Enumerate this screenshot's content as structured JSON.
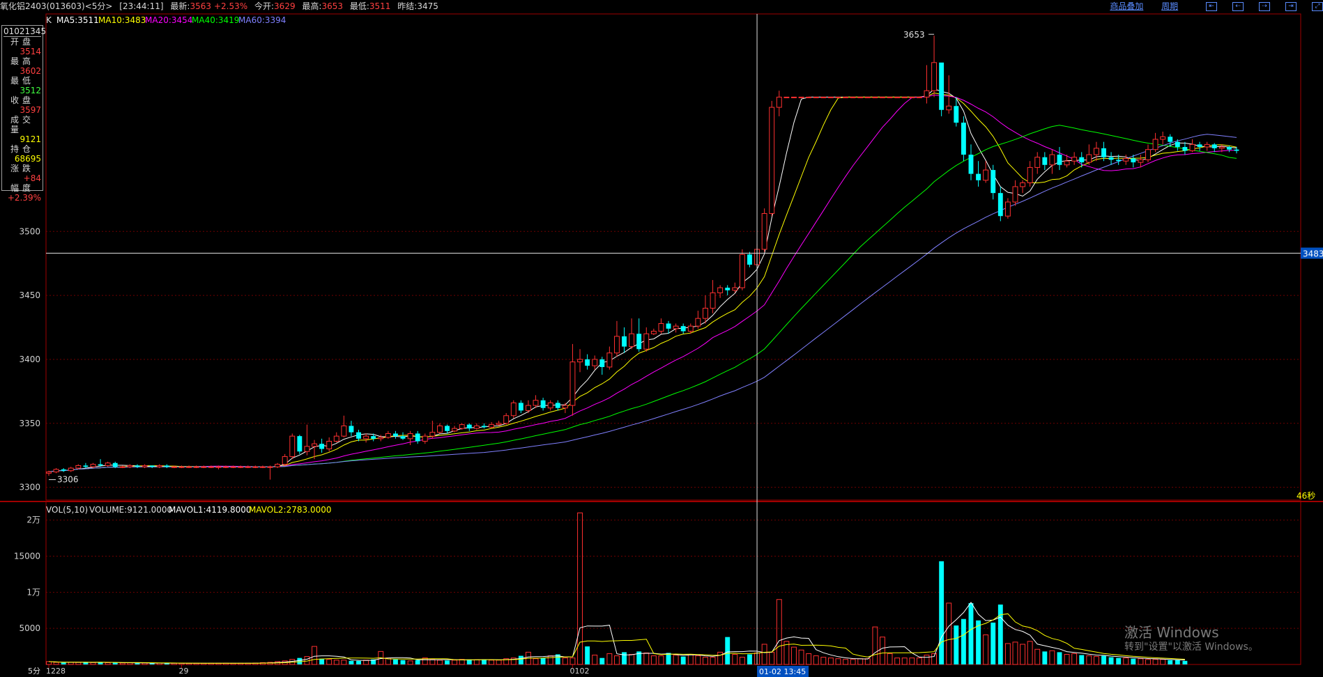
{
  "header": {
    "symbol": "氧化铝2403(013603)<5分>",
    "time": "[23:44:11]",
    "latest_label": "最新:",
    "latest": "3563",
    "change_pct": "+2.53%",
    "open_label": "今开:",
    "open": "3629",
    "high_label": "最高:",
    "high": "3653",
    "low_label": "最低:",
    "low": "3511",
    "prev_label": "昨结:",
    "prev": "3475",
    "overlay_link": "商品叠加",
    "period_link": "周期"
  },
  "info_panel": {
    "code": "01021345",
    "rows": [
      {
        "label": "开盘",
        "value": "3514",
        "color": "#ff4040"
      },
      {
        "label": "最高",
        "value": "3602",
        "color": "#ff4040"
      },
      {
        "label": "最低",
        "value": "3512",
        "color": "#40ff40"
      },
      {
        "label": "收盘",
        "value": "3597",
        "color": "#ff4040"
      },
      {
        "label": "成交量",
        "value": "9121",
        "color": "#ffff00"
      },
      {
        "label": "持仓",
        "value": "68695",
        "color": "#ffff00"
      },
      {
        "label": "涨跌",
        "value": "+84",
        "color": "#ff4040"
      },
      {
        "label": "幅度",
        "value": "+2.39%",
        "color": "#ff4040"
      }
    ]
  },
  "ma_legend": {
    "k": "K",
    "ma5": "MA5:3511",
    "ma10": "MA10:3483",
    "ma20": "MA20:3454",
    "ma40": "MA40:3419",
    "ma60": "MA60:3394",
    "colors": {
      "ma5": "#ffffff",
      "ma10": "#ffff00",
      "ma20": "#ff00ff",
      "ma40": "#00ff00",
      "ma60": "#8080ff"
    }
  },
  "vol_legend": {
    "prefix": "VOL(5,10)",
    "volume": "VOLUME:9121.0000",
    "mavol1": "MAVOL1:4119.8000",
    "mavol2": "MAVOL2:2783.0000"
  },
  "annotations": {
    "max_label": "3653",
    "min_label": "3306",
    "crosshair_price": "3483",
    "crosshair_time": "01-02 13:45",
    "countdown": "46秒",
    "period": "5分"
  },
  "watermark": {
    "line1": "激活 Windows",
    "line2": "转到\"设置\"以激活 Windows。"
  },
  "chart_data": {
    "type": "candlestick",
    "price_axis": {
      "ticks": [
        3300,
        3350,
        3400,
        3450,
        3500
      ],
      "range": [
        3290,
        3670
      ]
    },
    "volume_axis": {
      "ticks": [
        "5000",
        "1万",
        "15000",
        "2万"
      ],
      "tick_values": [
        5000,
        10000,
        15000,
        20000
      ],
      "range": [
        0,
        22000
      ]
    },
    "x_labels": [
      {
        "label": "1228",
        "index": 0
      },
      {
        "label": "29",
        "index": 18
      },
      {
        "label": "0102",
        "index": 71
      }
    ],
    "crosshair_index": 96,
    "candles": [
      [
        3311,
        3312,
        3309,
        3313
      ],
      [
        3312,
        3314,
        3311,
        3315
      ],
      [
        3314,
        3313,
        3312,
        3315
      ],
      [
        3313,
        3315,
        3312,
        3316
      ],
      [
        3315,
        3317,
        3314,
        3318
      ],
      [
        3317,
        3316,
        3315,
        3319
      ],
      [
        3316,
        3318,
        3315,
        3319
      ],
      [
        3318,
        3317,
        3316,
        3322
      ],
      [
        3317,
        3319,
        3316,
        3320
      ],
      [
        3319,
        3316,
        3315,
        3320
      ],
      [
        3316,
        3316,
        3315,
        3317
      ],
      [
        3316,
        3317,
        3315,
        3318
      ],
      [
        3317,
        3316,
        3315,
        3318
      ],
      [
        3316,
        3317,
        3315,
        3318
      ],
      [
        3317,
        3316,
        3315,
        3317
      ],
      [
        3316,
        3317,
        3315,
        3318
      ],
      [
        3317,
        3316,
        3315,
        3318
      ],
      [
        3316,
        3316,
        3315,
        3317
      ],
      [
        3316,
        3316,
        3315,
        3317
      ],
      [
        3316,
        3316,
        3315,
        3317
      ],
      [
        3316,
        3316,
        3315,
        3317
      ],
      [
        3316,
        3316,
        3315,
        3317
      ],
      [
        3316,
        3316,
        3315,
        3317
      ],
      [
        3316,
        3316,
        3314,
        3317
      ],
      [
        3316,
        3316,
        3315,
        3317
      ],
      [
        3316,
        3316,
        3315,
        3317
      ],
      [
        3316,
        3316,
        3315,
        3317
      ],
      [
        3316,
        3316,
        3315,
        3317
      ],
      [
        3316,
        3316,
        3315,
        3317
      ],
      [
        3316,
        3316,
        3315,
        3317
      ],
      [
        3316,
        3316,
        3306,
        3317
      ],
      [
        3316,
        3318,
        3315,
        3319
      ],
      [
        3318,
        3324,
        3317,
        3326
      ],
      [
        3324,
        3340,
        3322,
        3342
      ],
      [
        3340,
        3328,
        3326,
        3341
      ],
      [
        3328,
        3332,
        3325,
        3349
      ],
      [
        3332,
        3334,
        3322,
        3337
      ],
      [
        3334,
        3330,
        3327,
        3338
      ],
      [
        3330,
        3336,
        3328,
        3339
      ],
      [
        3336,
        3340,
        3335,
        3343
      ],
      [
        3340,
        3348,
        3339,
        3356
      ],
      [
        3348,
        3343,
        3340,
        3352
      ],
      [
        3343,
        3338,
        3336,
        3345
      ],
      [
        3338,
        3340,
        3335,
        3342
      ],
      [
        3340,
        3338,
        3336,
        3342
      ],
      [
        3338,
        3339,
        3336,
        3341
      ],
      [
        3339,
        3342,
        3338,
        3344
      ],
      [
        3342,
        3340,
        3338,
        3344
      ],
      [
        3340,
        3338,
        3337,
        3343
      ],
      [
        3338,
        3342,
        3333,
        3344
      ],
      [
        3342,
        3336,
        3334,
        3344
      ],
      [
        3336,
        3340,
        3334,
        3342
      ],
      [
        3340,
        3343,
        3338,
        3352
      ],
      [
        3343,
        3348,
        3342,
        3350
      ],
      [
        3348,
        3344,
        3342,
        3349
      ],
      [
        3344,
        3346,
        3343,
        3348
      ],
      [
        3346,
        3349,
        3345,
        3350
      ],
      [
        3349,
        3346,
        3344,
        3350
      ],
      [
        3346,
        3348,
        3345,
        3350
      ],
      [
        3348,
        3347,
        3346,
        3350
      ],
      [
        3347,
        3349,
        3346,
        3351
      ],
      [
        3349,
        3350,
        3348,
        3352
      ],
      [
        3350,
        3356,
        3349,
        3358
      ],
      [
        3356,
        3366,
        3354,
        3368
      ],
      [
        3366,
        3360,
        3358,
        3368
      ],
      [
        3360,
        3364,
        3358,
        3368
      ],
      [
        3364,
        3368,
        3362,
        3372
      ],
      [
        3368,
        3362,
        3360,
        3370
      ],
      [
        3362,
        3366,
        3360,
        3368
      ],
      [
        3366,
        3362,
        3360,
        3368
      ],
      [
        3362,
        3364,
        3358,
        3366
      ],
      [
        3364,
        3398,
        3356,
        3412
      ],
      [
        3398,
        3400,
        3390,
        3408
      ],
      [
        3400,
        3395,
        3392,
        3404
      ],
      [
        3395,
        3400,
        3392,
        3403
      ],
      [
        3400,
        3394,
        3388,
        3402
      ],
      [
        3394,
        3405,
        3392,
        3410
      ],
      [
        3405,
        3418,
        3402,
        3430
      ],
      [
        3418,
        3410,
        3405,
        3425
      ],
      [
        3410,
        3420,
        3408,
        3432
      ],
      [
        3420,
        3408,
        3406,
        3432
      ],
      [
        3408,
        3420,
        3406,
        3425
      ],
      [
        3420,
        3422,
        3419,
        3424
      ],
      [
        3422,
        3428,
        3420,
        3432
      ],
      [
        3428,
        3424,
        3420,
        3430
      ],
      [
        3424,
        3426,
        3421,
        3428
      ],
      [
        3426,
        3422,
        3420,
        3428
      ],
      [
        3422,
        3426,
        3420,
        3428
      ],
      [
        3426,
        3432,
        3424,
        3438
      ],
      [
        3432,
        3440,
        3428,
        3450
      ],
      [
        3440,
        3452,
        3436,
        3462
      ],
      [
        3452,
        3456,
        3448,
        3458
      ],
      [
        3456,
        3454,
        3450,
        3458
      ],
      [
        3454,
        3456,
        3452,
        3460
      ],
      [
        3456,
        3482,
        3454,
        3486
      ],
      [
        3482,
        3474,
        3472,
        3484
      ],
      [
        3474,
        3486,
        3472,
        3490
      ],
      [
        3486,
        3514,
        3484,
        3518
      ],
      [
        3514,
        3597,
        3512,
        3602
      ],
      [
        3597,
        3605,
        3590,
        3610
      ],
      [
        3605,
        3605,
        3605,
        3605
      ],
      [
        3605,
        3605,
        3605,
        3605
      ],
      [
        3605,
        3605,
        3605,
        3605
      ],
      [
        3605,
        3605,
        3605,
        3605
      ],
      [
        3605,
        3605,
        3605,
        3605
      ],
      [
        3605,
        3605,
        3605,
        3605
      ],
      [
        3605,
        3605,
        3605,
        3605
      ],
      [
        3605,
        3605,
        3605,
        3605
      ],
      [
        3605,
        3605,
        3605,
        3605
      ],
      [
        3605,
        3605,
        3605,
        3605
      ],
      [
        3605,
        3605,
        3605,
        3605
      ],
      [
        3605,
        3605,
        3605,
        3605
      ],
      [
        3605,
        3605,
        3605,
        3605
      ],
      [
        3605,
        3605,
        3605,
        3605
      ],
      [
        3605,
        3605,
        3605,
        3605
      ],
      [
        3605,
        3605,
        3605,
        3605
      ],
      [
        3605,
        3605,
        3605,
        3605
      ],
      [
        3605,
        3605,
        3605,
        3605
      ],
      [
        3605,
        3605,
        3605,
        3605
      ],
      [
        3605,
        3610,
        3600,
        3630
      ],
      [
        3610,
        3632,
        3605,
        3653
      ],
      [
        3632,
        3595,
        3590,
        3620
      ],
      [
        3595,
        3598,
        3592,
        3622
      ],
      [
        3598,
        3585,
        3582,
        3605
      ],
      [
        3585,
        3560,
        3555,
        3590
      ],
      [
        3560,
        3545,
        3540,
        3568
      ],
      [
        3545,
        3540,
        3535,
        3555
      ],
      [
        3540,
        3548,
        3538,
        3555
      ],
      [
        3548,
        3530,
        3525,
        3552
      ],
      [
        3530,
        3512,
        3508,
        3535
      ],
      [
        3512,
        3523,
        3510,
        3526
      ],
      [
        3523,
        3535,
        3520,
        3540
      ],
      [
        3535,
        3538,
        3530,
        3540
      ],
      [
        3538,
        3550,
        3535,
        3555
      ],
      [
        3550,
        3558,
        3545,
        3562
      ],
      [
        3558,
        3552,
        3548,
        3562
      ],
      [
        3552,
        3560,
        3545,
        3564
      ],
      [
        3560,
        3552,
        3548,
        3566
      ],
      [
        3552,
        3555,
        3550,
        3560
      ],
      [
        3555,
        3558,
        3552,
        3562
      ],
      [
        3558,
        3554,
        3550,
        3562
      ],
      [
        3554,
        3560,
        3552,
        3568
      ],
      [
        3560,
        3565,
        3555,
        3570
      ],
      [
        3565,
        3558,
        3555,
        3570
      ],
      [
        3558,
        3556,
        3552,
        3562
      ],
      [
        3556,
        3555,
        3552,
        3560
      ],
      [
        3555,
        3557,
        3552,
        3560
      ],
      [
        3557,
        3554,
        3550,
        3560
      ],
      [
        3554,
        3556,
        3550,
        3560
      ],
      [
        3556,
        3564,
        3554,
        3568
      ],
      [
        3564,
        3572,
        3562,
        3577
      ],
      [
        3572,
        3574,
        3568,
        3578
      ],
      [
        3574,
        3570,
        3566,
        3576
      ],
      [
        3570,
        3566,
        3563,
        3572
      ],
      [
        3566,
        3563,
        3560,
        3570
      ],
      [
        3563,
        3568,
        3562,
        3572
      ],
      [
        3568,
        3566,
        3563,
        3570
      ],
      [
        3566,
        3568,
        3563,
        3570
      ],
      [
        3568,
        3565,
        3562,
        3569
      ],
      [
        3565,
        3566,
        3562,
        3568
      ],
      [
        3566,
        3564,
        3562,
        3567
      ],
      [
        3564,
        3563,
        3561,
        3566
      ]
    ],
    "volumes": [
      400,
      300,
      250,
      300,
      280,
      350,
      260,
      300,
      240,
      250,
      200,
      220,
      180,
      200,
      180,
      190,
      180,
      170,
      170,
      160,
      160,
      160,
      170,
      170,
      180,
      160,
      170,
      180,
      200,
      250,
      300,
      400,
      500,
      700,
      900,
      1100,
      2500,
      800,
      700,
      600,
      600,
      500,
      500,
      600,
      700,
      1800,
      900,
      700,
      600,
      500,
      600,
      900,
      700,
      600,
      550,
      600,
      700,
      700,
      650,
      700,
      600,
      600,
      800,
      900,
      1200,
      1700,
      800,
      900,
      1200,
      1400,
      900,
      900,
      21000,
      2500,
      1300,
      900,
      1500,
      1200,
      1700,
      1400,
      1800,
      1600,
      1200,
      1200,
      1600,
      1300,
      1100,
      1400,
      1200,
      1000,
      1000,
      1700,
      3800,
      1400,
      1000,
      1400,
      1600,
      2800,
      1700,
      9000,
      3200,
      2400,
      2000,
      1500,
      1200,
      1000,
      900,
      800,
      700,
      700,
      800,
      800,
      5200,
      3800,
      1500,
      900,
      900,
      900,
      900,
      1300,
      1500,
      14300,
      8500,
      5400,
      6300,
      8500,
      6100,
      4100,
      5800,
      8300,
      2900,
      3100,
      2800,
      3200,
      2100,
      1800,
      1900,
      1700,
      1400,
      1500,
      1300,
      1200,
      1100,
      1200,
      1000,
      900,
      900,
      800,
      800,
      700,
      700,
      700,
      600,
      600,
      500
    ],
    "last_volume": 9121,
    "ma_values": {
      "ma5": 3511,
      "ma10": 3483,
      "ma20": 3454,
      "ma40": 3419,
      "ma60": 3394
    },
    "mavol_values": {
      "mavol1": 4119.8,
      "mavol2": 2783.0
    }
  }
}
